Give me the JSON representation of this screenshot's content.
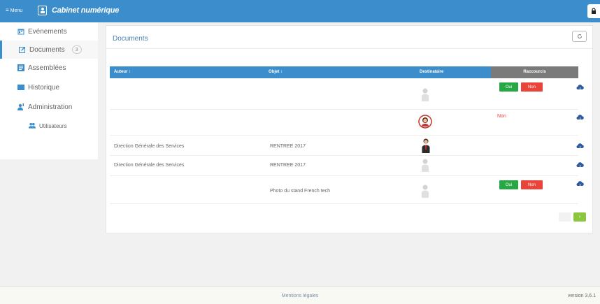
{
  "topbar": {
    "menu_label": "Menu",
    "menu_icon": "hamburger-icon",
    "app_title": "Cabinet numérique",
    "accent_color": "#3c8dcb"
  },
  "sidebar": {
    "items": [
      {
        "label": "Evénements",
        "icon": "calendar-icon"
      },
      {
        "label": "Documents",
        "icon": "edit-icon",
        "badge": "3"
      },
      {
        "label": "Assemblées",
        "icon": "assembly-icon"
      },
      {
        "label": "Historique",
        "icon": "history-icon"
      },
      {
        "label": "Administration",
        "icon": "admin-icon"
      },
      {
        "label": "Utilisateurs",
        "icon": "users-icon"
      }
    ]
  },
  "main": {
    "title": "Documents",
    "table": {
      "headers": {
        "auteur": "Auteur ↕",
        "objet": "Objet ↕",
        "destinataire": "Destinataire",
        "raccourcis": "Raccourcis"
      },
      "rows": [
        {
          "auteur": "",
          "objet": "",
          "avatar": "placeholder",
          "buttons": true,
          "non_text": ""
        },
        {
          "auteur": "",
          "objet": "",
          "avatar": "woman",
          "buttons": false,
          "non_text": "Non"
        },
        {
          "auteur": "Direction Générale des Services",
          "objet": "RENTREE 2017",
          "avatar": "man",
          "buttons": false,
          "non_text": ""
        },
        {
          "auteur": "Direction Générale des Services",
          "objet": "RENTREE 2017",
          "avatar": "placeholder",
          "buttons": false,
          "non_text": ""
        },
        {
          "auteur": "",
          "objet": "Photo du stand French tech",
          "avatar": "placeholder",
          "buttons": true,
          "non_text": ""
        }
      ],
      "oui_label": "Oui",
      "non_label": "Non"
    },
    "pager_next": "›"
  },
  "footer": {
    "link": "Mentions légales",
    "version": "version 3.6.1"
  },
  "colors": {
    "oui": "#28a745",
    "non": "#e9443a",
    "pager_next": "#8cc63f",
    "header_gray": "#7a7a7a"
  }
}
